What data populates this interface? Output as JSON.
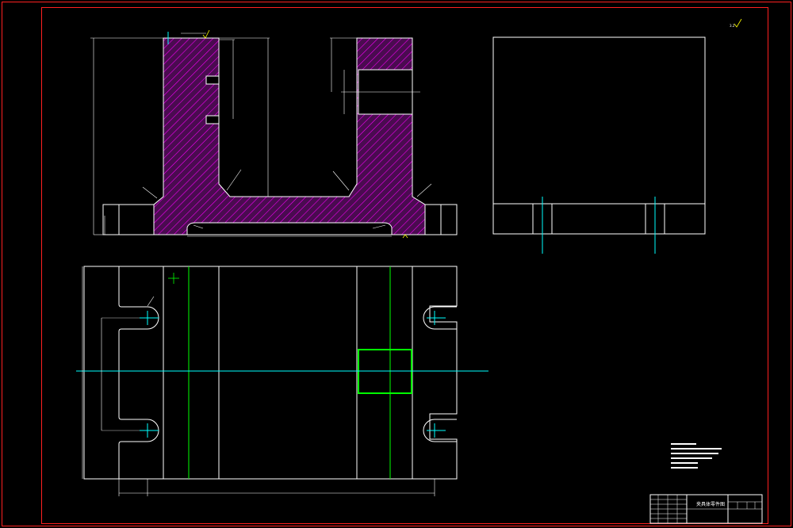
{
  "drawing": {
    "roughness_symbol": "3.2",
    "title_block_name": "夹具体零件图"
  },
  "colors": {
    "frame": "#ff2020",
    "line": "#ffffff",
    "hatch": "#ff00ff",
    "center": "#00ffff",
    "green": "#00ff00"
  }
}
